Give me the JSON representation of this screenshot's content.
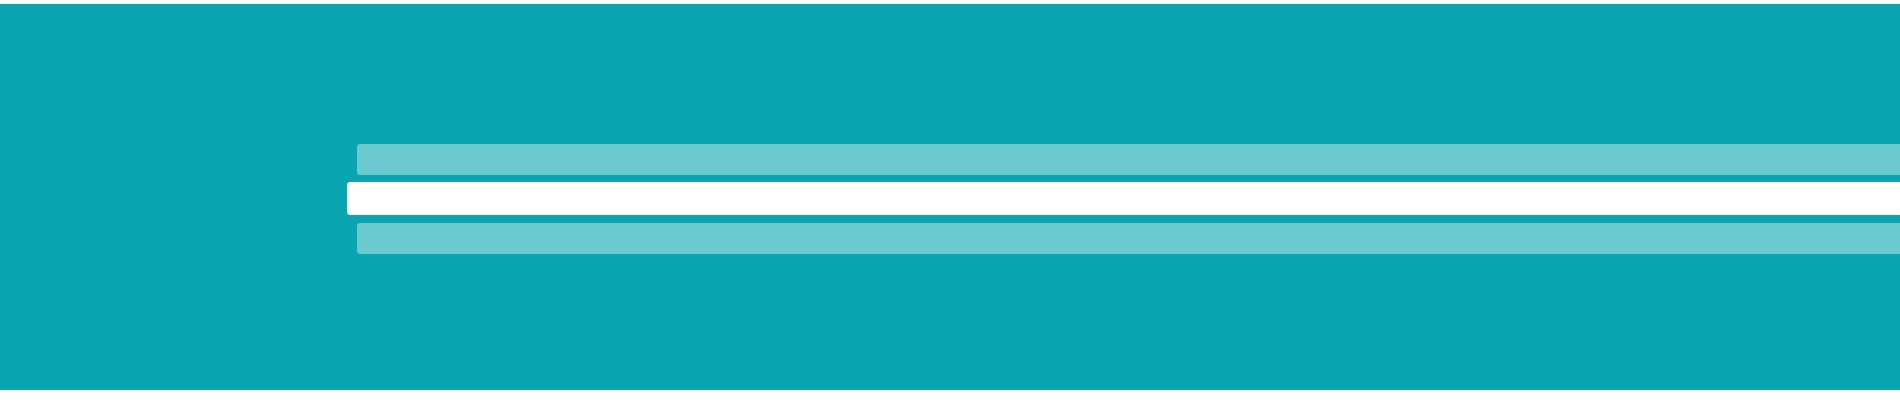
{
  "theme": {
    "background": "#0ba5b2",
    "inactive_row": "#6bcacf",
    "active_row": "#ffffff"
  },
  "rows": [
    {
      "state": "inactive"
    },
    {
      "state": "active"
    },
    {
      "state": "inactive"
    }
  ]
}
